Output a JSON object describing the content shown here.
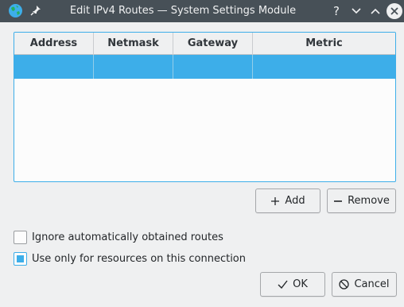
{
  "window": {
    "title": "Edit IPv4 Routes — System Settings Module",
    "icons": {
      "app": "globe-icon",
      "pin": "pin-icon",
      "help": "help-icon",
      "minimize": "minimize-icon",
      "maximize": "maximize-icon",
      "close": "close-icon"
    }
  },
  "table": {
    "columns": [
      "Address",
      "Netmask",
      "Gateway",
      "Metric"
    ],
    "rows": [
      {
        "address": "",
        "netmask": "",
        "gateway": "",
        "metric": "",
        "selected": true
      }
    ]
  },
  "route_actions": {
    "add_label": "Add",
    "remove_label": "Remove"
  },
  "options": {
    "ignore_auto": {
      "label": "Ignore automatically obtained routes",
      "checked": false
    },
    "only_resources": {
      "label": "Use only for resources on this connection",
      "checked": true
    }
  },
  "dialog_buttons": {
    "ok_label": "OK",
    "cancel_label": "Cancel"
  },
  "colors": {
    "accent": "#3daee9",
    "titlebar": "#475057",
    "background": "#eff0f1"
  }
}
